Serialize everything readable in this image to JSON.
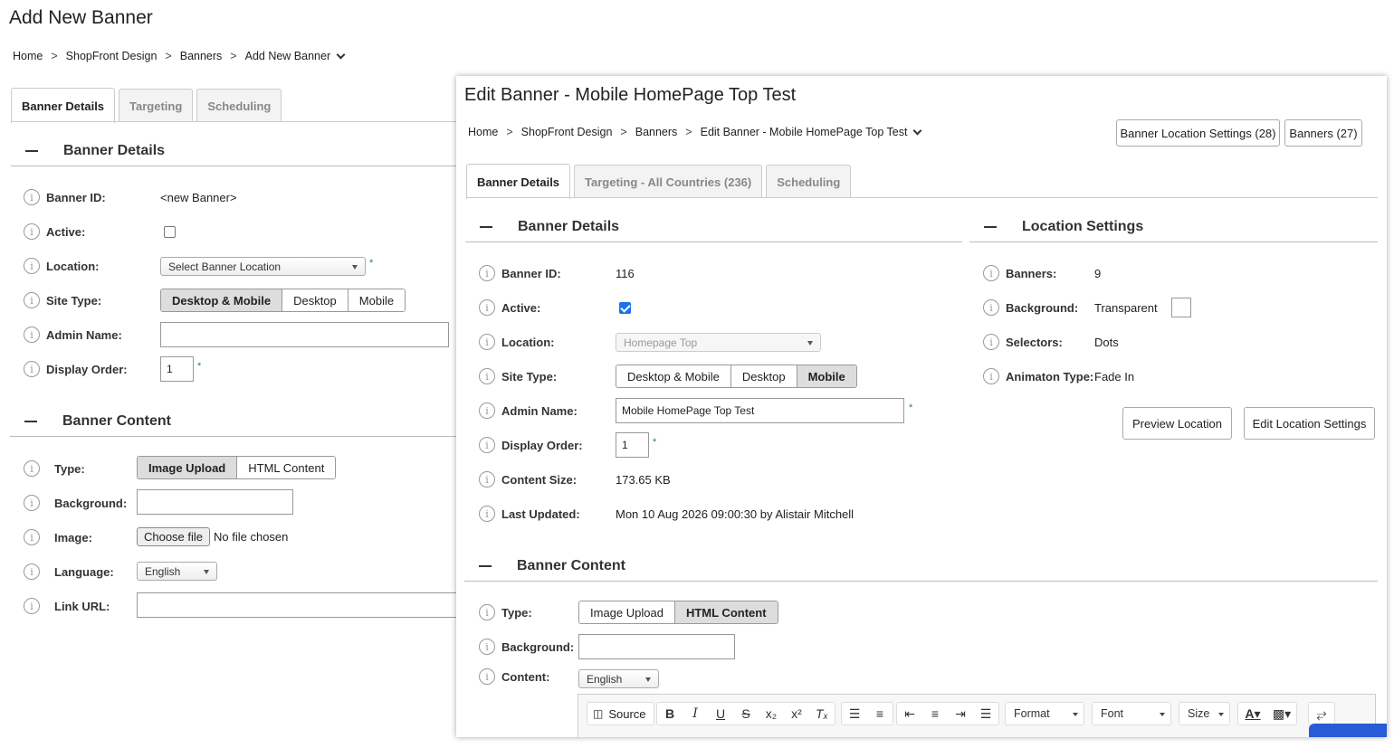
{
  "bg_page": {
    "title": "Add New Banner",
    "breadcrumb": [
      "Home",
      "ShopFront Design",
      "Banners",
      "Add New Banner"
    ],
    "tabs": [
      "Banner Details",
      "Targeting",
      "Scheduling"
    ],
    "details_section": "Banner Details",
    "fields": {
      "banner_id_label": "Banner ID:",
      "banner_id_value": "<new Banner>",
      "active_label": "Active:",
      "location_label": "Location:",
      "location_value": "Select Banner Location",
      "site_type_label": "Site Type:",
      "site_type_options": [
        "Desktop & Mobile",
        "Desktop",
        "Mobile"
      ],
      "admin_name_label": "Admin Name:",
      "display_order_label": "Display Order:",
      "display_order_value": "1"
    },
    "content_section": "Banner Content",
    "content": {
      "type_label": "Type:",
      "type_options": [
        "Image Upload",
        "HTML Content"
      ],
      "background_label": "Background:",
      "image_label": "Image:",
      "choose_file": "Choose file",
      "no_file": "No file chosen",
      "language_label": "Language:",
      "language_value": "English",
      "link_label": "Link URL:"
    },
    "required_mark": "*"
  },
  "modal": {
    "title": "Edit Banner - Mobile HomePage Top Test",
    "breadcrumb": [
      "Home",
      "ShopFront Design",
      "Banners",
      "Edit Banner - Mobile HomePage Top Test"
    ],
    "header_buttons": [
      "Banner Location Settings (28)",
      "Banners (27)"
    ],
    "tabs": [
      "Banner Details",
      "Targeting - All Countries (236)",
      "Scheduling"
    ],
    "details_section": "Banner Details",
    "fields": {
      "banner_id_label": "Banner ID:",
      "banner_id_value": "116",
      "active_label": "Active:",
      "location_label": "Location:",
      "location_value": "Homepage Top",
      "site_type_label": "Site Type:",
      "site_type_options": [
        "Desktop & Mobile",
        "Desktop",
        "Mobile"
      ],
      "admin_name_label": "Admin Name:",
      "admin_name_value": "Mobile HomePage Top Test",
      "display_order_label": "Display Order:",
      "display_order_value": "1",
      "content_size_label": "Content Size:",
      "content_size_value": "173.65 KB",
      "last_updated_label": "Last Updated:",
      "last_updated_value": "Mon 10 Aug 2026 09:00:30 by Alistair Mitchell"
    },
    "location_section": "Location Settings",
    "location": {
      "banners_label": "Banners:",
      "banners_value": "9",
      "background_label": "Background:",
      "background_value": "Transparent",
      "selectors_label": "Selectors:",
      "selectors_value": "Dots",
      "animation_label": "Animaton Type:",
      "animation_value": "Fade In",
      "preview_button": "Preview Location",
      "edit_button": "Edit Location Settings"
    },
    "content_section": "Banner Content",
    "content": {
      "type_label": "Type:",
      "type_options": [
        "Image Upload",
        "HTML Content"
      ],
      "background_label": "Background:",
      "content_label": "Content:",
      "language_value": "English"
    },
    "editor": {
      "source": "Source",
      "format": "Format",
      "font": "Font",
      "size": "Size"
    },
    "required_mark": "*"
  }
}
